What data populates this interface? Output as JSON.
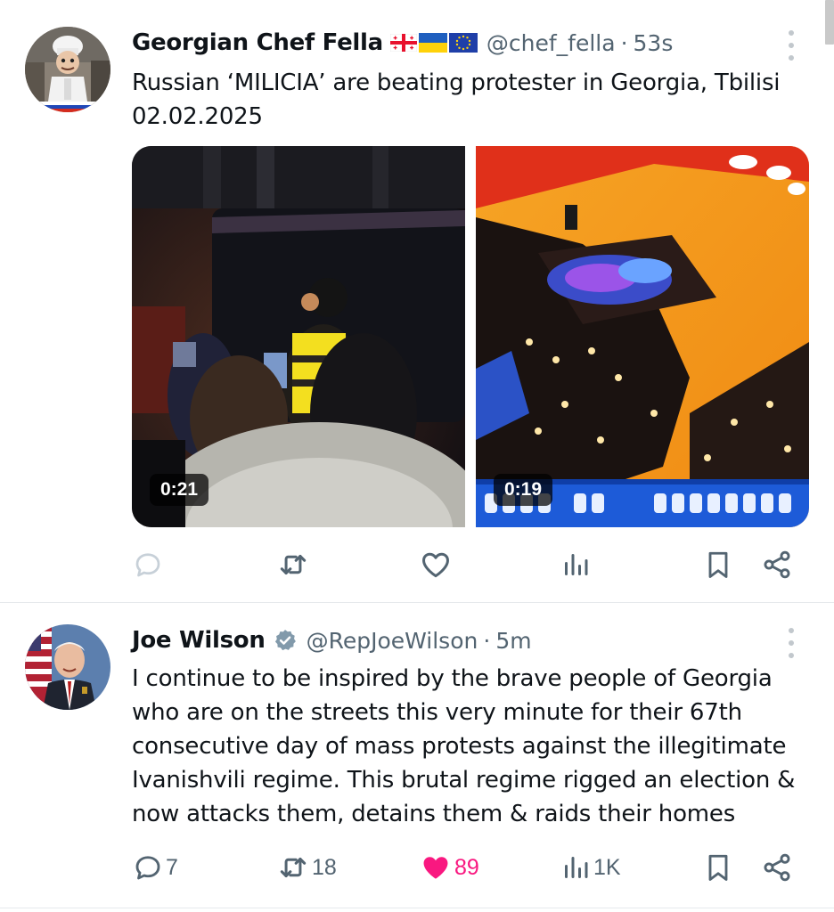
{
  "tweets": [
    {
      "display_name": "Georgian Chef Fella",
      "flags": [
        "georgia-flag-icon",
        "ukraine-flag-icon",
        "eu-flag-icon"
      ],
      "handle": "@chef_fella",
      "separator": "·",
      "time": "53s",
      "text_lines": [
        "Russian ‘MILICIA’ are beating protester in Georgia, Tbilisi",
        "02.02.2025"
      ],
      "media": [
        {
          "duration": "0:21",
          "icon": "video-thumbnail"
        },
        {
          "duration": "0:19",
          "icon": "video-thumbnail"
        }
      ],
      "actions": {
        "replies": "",
        "reposts": "",
        "likes": "",
        "views": "",
        "liked": false
      }
    },
    {
      "display_name": "Joe Wilson",
      "verified": true,
      "handle": "@RepJoeWilson",
      "separator": "·",
      "time": "5m",
      "text_lines": [
        "I continue to be inspired by the brave people of Georgia",
        "who are on the streets this very minute for their 67th",
        "consecutive day of mass protests against the illegitimate",
        "Ivanishvili regime. This brutal regime rigged an election &",
        "now attacks them, detains them & raids their homes"
      ],
      "actions": {
        "replies": "7",
        "reposts": "18",
        "likes": "89",
        "views": "1K",
        "liked": true
      }
    }
  ],
  "colors": {
    "text_primary": "#0f1419",
    "text_secondary": "#536471",
    "like_pink": "#f91880",
    "verified_gray": "#829aab",
    "divider": "#e6e9ec"
  }
}
